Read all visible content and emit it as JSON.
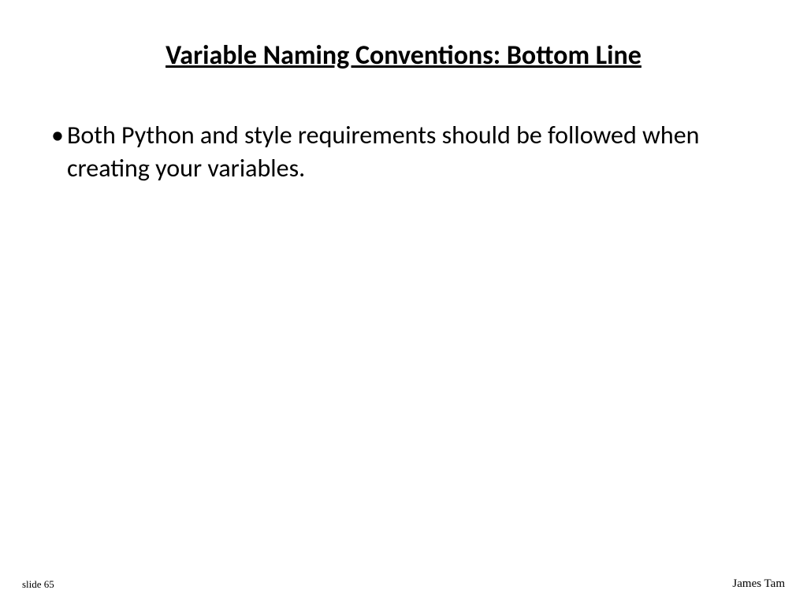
{
  "slide": {
    "title": "Variable Naming Conventions: Bottom Line",
    "bullets": [
      {
        "text": "Both Python and style requirements should be followed when creating your variables."
      }
    ]
  },
  "footer": {
    "slide_label": "slide 65",
    "author": "James Tam"
  }
}
